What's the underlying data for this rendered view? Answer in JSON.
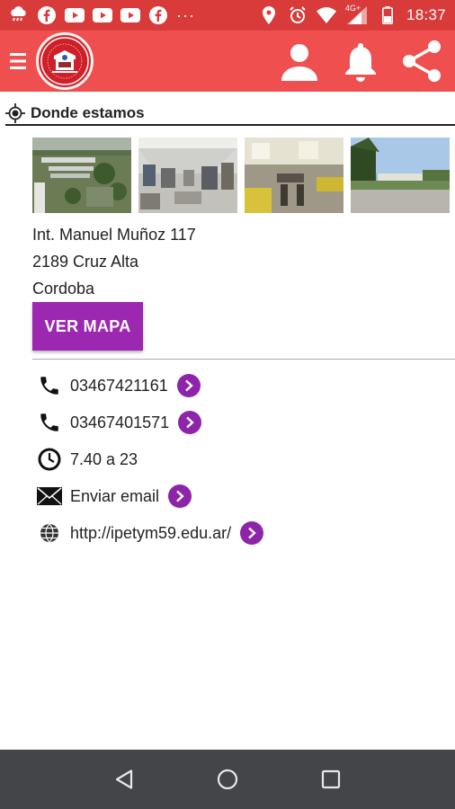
{
  "status_bar": {
    "time": "18:37",
    "network": "4G+",
    "left_icons": [
      "weather-icon",
      "facebook-icon",
      "youtube-icon",
      "youtube-icon",
      "youtube-icon",
      "facebook-icon"
    ],
    "overflow": "···"
  },
  "app_bar": {
    "bg_color": "#ef4f4f",
    "status_color": "#d93a3a"
  },
  "section": {
    "title": "Donde estamos"
  },
  "address": {
    "line1": "Int. Manuel Muñoz 117",
    "line2": "2189 Cruz Alta",
    "line3": "Cordoba"
  },
  "map_button": {
    "label": "VER MAPA",
    "color": "#9c27b0"
  },
  "contacts": [
    {
      "icon": "phone-icon",
      "text": "03467421161",
      "action": true
    },
    {
      "icon": "phone-icon",
      "text": "03467401571",
      "action": true
    },
    {
      "icon": "clock-icon",
      "text": "7.40 a 23",
      "action": false
    },
    {
      "icon": "mail-icon",
      "text": "Enviar email",
      "action": true
    },
    {
      "icon": "globe-icon",
      "text": "http://ipetym59.edu.ar/",
      "action": true
    }
  ],
  "accent_color": "#8e24aa"
}
